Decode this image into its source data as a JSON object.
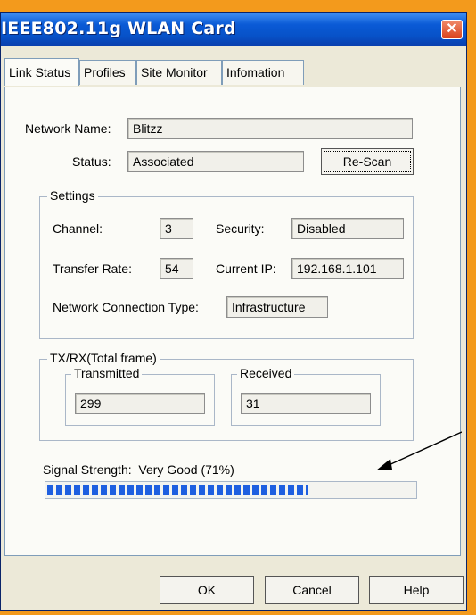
{
  "window": {
    "title": "IEEE802.11g WLAN Card",
    "close_glyph": "✕"
  },
  "tabs": [
    {
      "label": "Link Status",
      "active": true
    },
    {
      "label": "Profiles",
      "active": false
    },
    {
      "label": "Site Monitor",
      "active": false
    },
    {
      "label": "Infomation",
      "active": false
    }
  ],
  "link_status": {
    "network_name_label": "Network Name:",
    "network_name_value": "Blitzz",
    "status_label": "Status:",
    "status_value": "Associated",
    "rescan_label": "Re-Scan",
    "settings": {
      "title": "Settings",
      "channel_label": "Channel:",
      "channel_value": "3",
      "security_label": "Security:",
      "security_value": "Disabled",
      "transfer_rate_label": "Transfer Rate:",
      "transfer_rate_value": "54",
      "current_ip_label": "Current IP:",
      "current_ip_value": "192.168.1.101",
      "connection_type_label": "Network Connection Type:",
      "connection_type_value": "Infrastructure"
    },
    "txrx": {
      "title": "TX/RX(Total frame)",
      "transmitted_label": "Transmitted",
      "transmitted_value": "299",
      "received_label": "Received",
      "received_value": "31"
    },
    "signal": {
      "label": "Signal Strength:",
      "quality": "Very Good (71%)",
      "percent": 71
    }
  },
  "buttons": {
    "ok": "OK",
    "cancel": "Cancel",
    "help": "Help"
  },
  "colors": {
    "titlebar": "#0752c8",
    "signal_bar": "#1f5fe0",
    "background": "#f39a1c"
  },
  "annotation": {
    "icon": "arrow-pointer-icon"
  }
}
